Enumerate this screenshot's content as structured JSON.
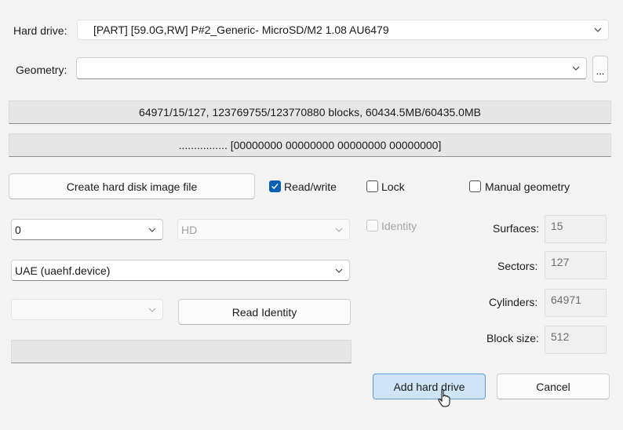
{
  "hard_drive": {
    "label": "Hard drive:",
    "value": "[PART] [59.0G,RW] P#2_Generic- MicroSD/M2 1.08 AU6479"
  },
  "geometry": {
    "label": "Geometry:",
    "value": "",
    "browse_label": "..."
  },
  "info_line": "64971/15/127, 123769755/123770880 blocks, 60434.5MB/60435.0MB",
  "hex_line": "................ [00000000 00000000 00000000 00000000]",
  "create_image_button": "Create hard disk image file",
  "checkboxes": {
    "read_write": {
      "label": "Read/write",
      "checked": true
    },
    "lock": {
      "label": "Lock",
      "checked": false
    },
    "manual_geometry": {
      "label": "Manual geometry",
      "checked": false
    },
    "identity": {
      "label": "Identity",
      "checked": false,
      "disabled": true
    }
  },
  "unit_select": {
    "value": "0"
  },
  "type_select": {
    "value": "HD",
    "disabled": true
  },
  "controller_select": {
    "value": "UAE (uaehf.device)"
  },
  "sub_select": {
    "value": "",
    "disabled": true
  },
  "read_identity_button": "Read Identity",
  "status_bar": "",
  "fields": {
    "surfaces": {
      "label": "Surfaces:",
      "value": "15"
    },
    "sectors": {
      "label": "Sectors:",
      "value": "127"
    },
    "cylinders": {
      "label": "Cylinders:",
      "value": "64971"
    },
    "block_size": {
      "label": "Block size:",
      "value": "512"
    }
  },
  "add_button": "Add hard drive",
  "cancel_button": "Cancel",
  "colors": {
    "accent": "#0a5fb4",
    "primary_button_bg": "#cfe4f7",
    "primary_button_border": "#5a9bd6"
  }
}
